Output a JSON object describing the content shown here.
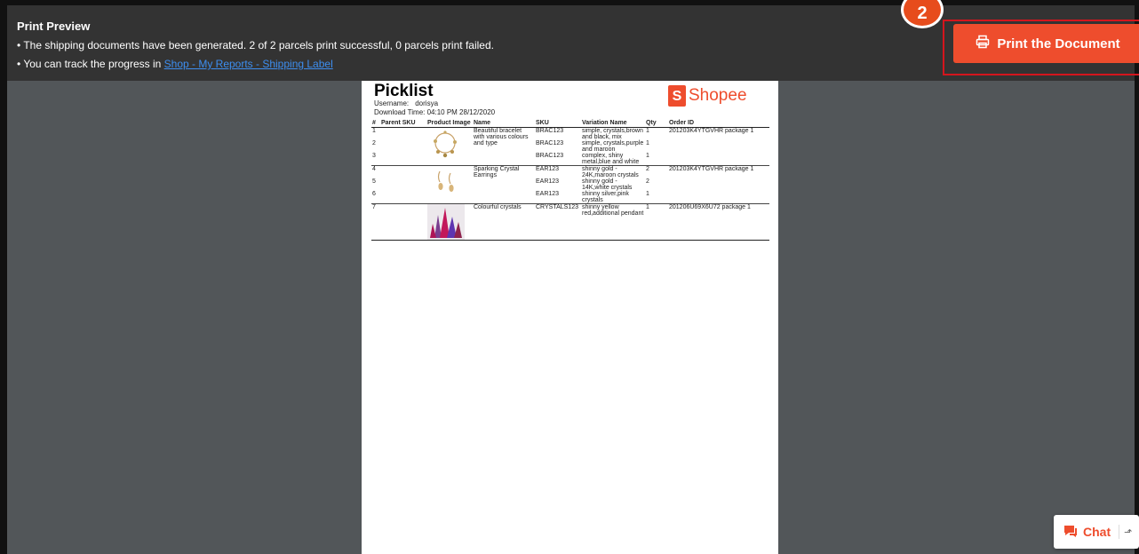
{
  "header": {
    "title": "Print Preview",
    "message_line1": "• The shipping documents have been generated. 2 of 2 parcels print successful, 0 parcels print failed.",
    "message_line2_prefix": "• You can track the progress in ",
    "message_line2_link": "Shop - My Reports - Shipping Label"
  },
  "step_badge": "2",
  "print_button": {
    "label": "Print the Document",
    "icon": "printer-icon"
  },
  "document": {
    "title": "Picklist",
    "username_label": "Username:",
    "username_value": "dorisya",
    "download_label": "Download Time:",
    "download_value": "04:10 PM 28/12/2020",
    "logo_text": "Shopee",
    "logo_letter": "S",
    "columns": [
      "#",
      "Parent SKU",
      "Product Image",
      "Name",
      "SKU",
      "Variation Name",
      "Qty",
      "Order ID"
    ],
    "rows": [
      {
        "num": "1",
        "parent_sku": "",
        "name": "Beautiful bracelet with various colours and type",
        "sku": "BRAC123",
        "variation": "simple, crystals,brown and black, mix",
        "qty": "1",
        "order_id": "201203K4YTGVHR package 1"
      },
      {
        "num": "2",
        "parent_sku": "",
        "name": "",
        "sku": "BRAC123",
        "variation": "simple, crystals,purple and maroon",
        "qty": "1",
        "order_id": ""
      },
      {
        "num": "3",
        "parent_sku": "",
        "name": "",
        "sku": "BRAC123",
        "variation": "complex, shiny metal,blue and white",
        "qty": "1",
        "order_id": ""
      },
      {
        "num": "4",
        "parent_sku": "",
        "name": "Sparking Crystal Earrings",
        "sku": "EAR123",
        "variation": "shinny gold - 24K,maroon crystals",
        "qty": "2",
        "order_id": "201203K4YTGVHR package 1"
      },
      {
        "num": "5",
        "parent_sku": "",
        "name": "",
        "sku": "EAR123",
        "variation": "shinny gold - 14K,white crystals",
        "qty": "2",
        "order_id": ""
      },
      {
        "num": "6",
        "parent_sku": "",
        "name": "",
        "sku": "EAR123",
        "variation": "shinny silver,pink crystals",
        "qty": "1",
        "order_id": ""
      },
      {
        "num": "7",
        "parent_sku": "",
        "name": "Colourful crystals",
        "sku": "CRYSTALS123",
        "variation": "shinny yellow red,additional pendant",
        "qty": "1",
        "order_id": "201206U69X6U72 package 1"
      }
    ]
  },
  "chat": {
    "label": "Chat",
    "icon": "chat-icon",
    "expand_icon": "expand-icon"
  },
  "colors": {
    "accent": "#ee4d2d",
    "highlight_border": "#d4151d",
    "link": "#3d8ef0"
  }
}
